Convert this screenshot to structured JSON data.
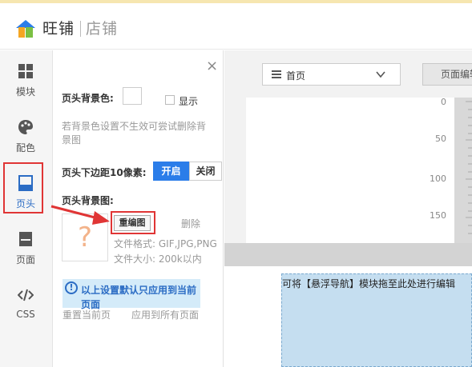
{
  "app": {
    "brand": "旺铺",
    "sub": "店铺"
  },
  "sidebar": {
    "items": [
      {
        "label": "模块",
        "icon": "grid-icon"
      },
      {
        "label": "配色",
        "icon": "palette-icon"
      },
      {
        "label": "页头",
        "icon": "page-header-icon",
        "active": true
      },
      {
        "label": "页面",
        "icon": "page-icon"
      },
      {
        "label": "CSS",
        "icon": "code-icon"
      }
    ]
  },
  "panel": {
    "close": "×",
    "bg_color_label": "页头背景色:",
    "show_label": "显示",
    "hint": "若背景色设置不生效可尝试删除背景图",
    "margin_label": "页头下边距10像素:",
    "toggle_on": "开启",
    "toggle_off": "关闭",
    "bg_image_label": "页头背景图:",
    "placeholder_glyph": "?",
    "reupload": "重编图",
    "delete": "删除",
    "file_format": "文件格式: GIF,JPG,PNG",
    "file_size": "文件大小: 200k以内",
    "notice_icon": "!",
    "notice": "以上设置默认只应用到当前页面",
    "reset": "重置当前页",
    "apply_all": "应用到所有页面"
  },
  "toolbar": {
    "page_select": "首页",
    "page_edit": "页面编辑"
  },
  "ruler": {
    "marks": [
      "0",
      "50",
      "100",
      "150"
    ]
  },
  "canvas": {
    "nav_drop_text": "可将【悬浮导航】模块拖至此处进行编辑"
  },
  "colors": {
    "accent": "#2b7de9",
    "highlight": "#e03535",
    "notice_bg": "#d4ebf9",
    "drop_bg": "#c5def0"
  }
}
